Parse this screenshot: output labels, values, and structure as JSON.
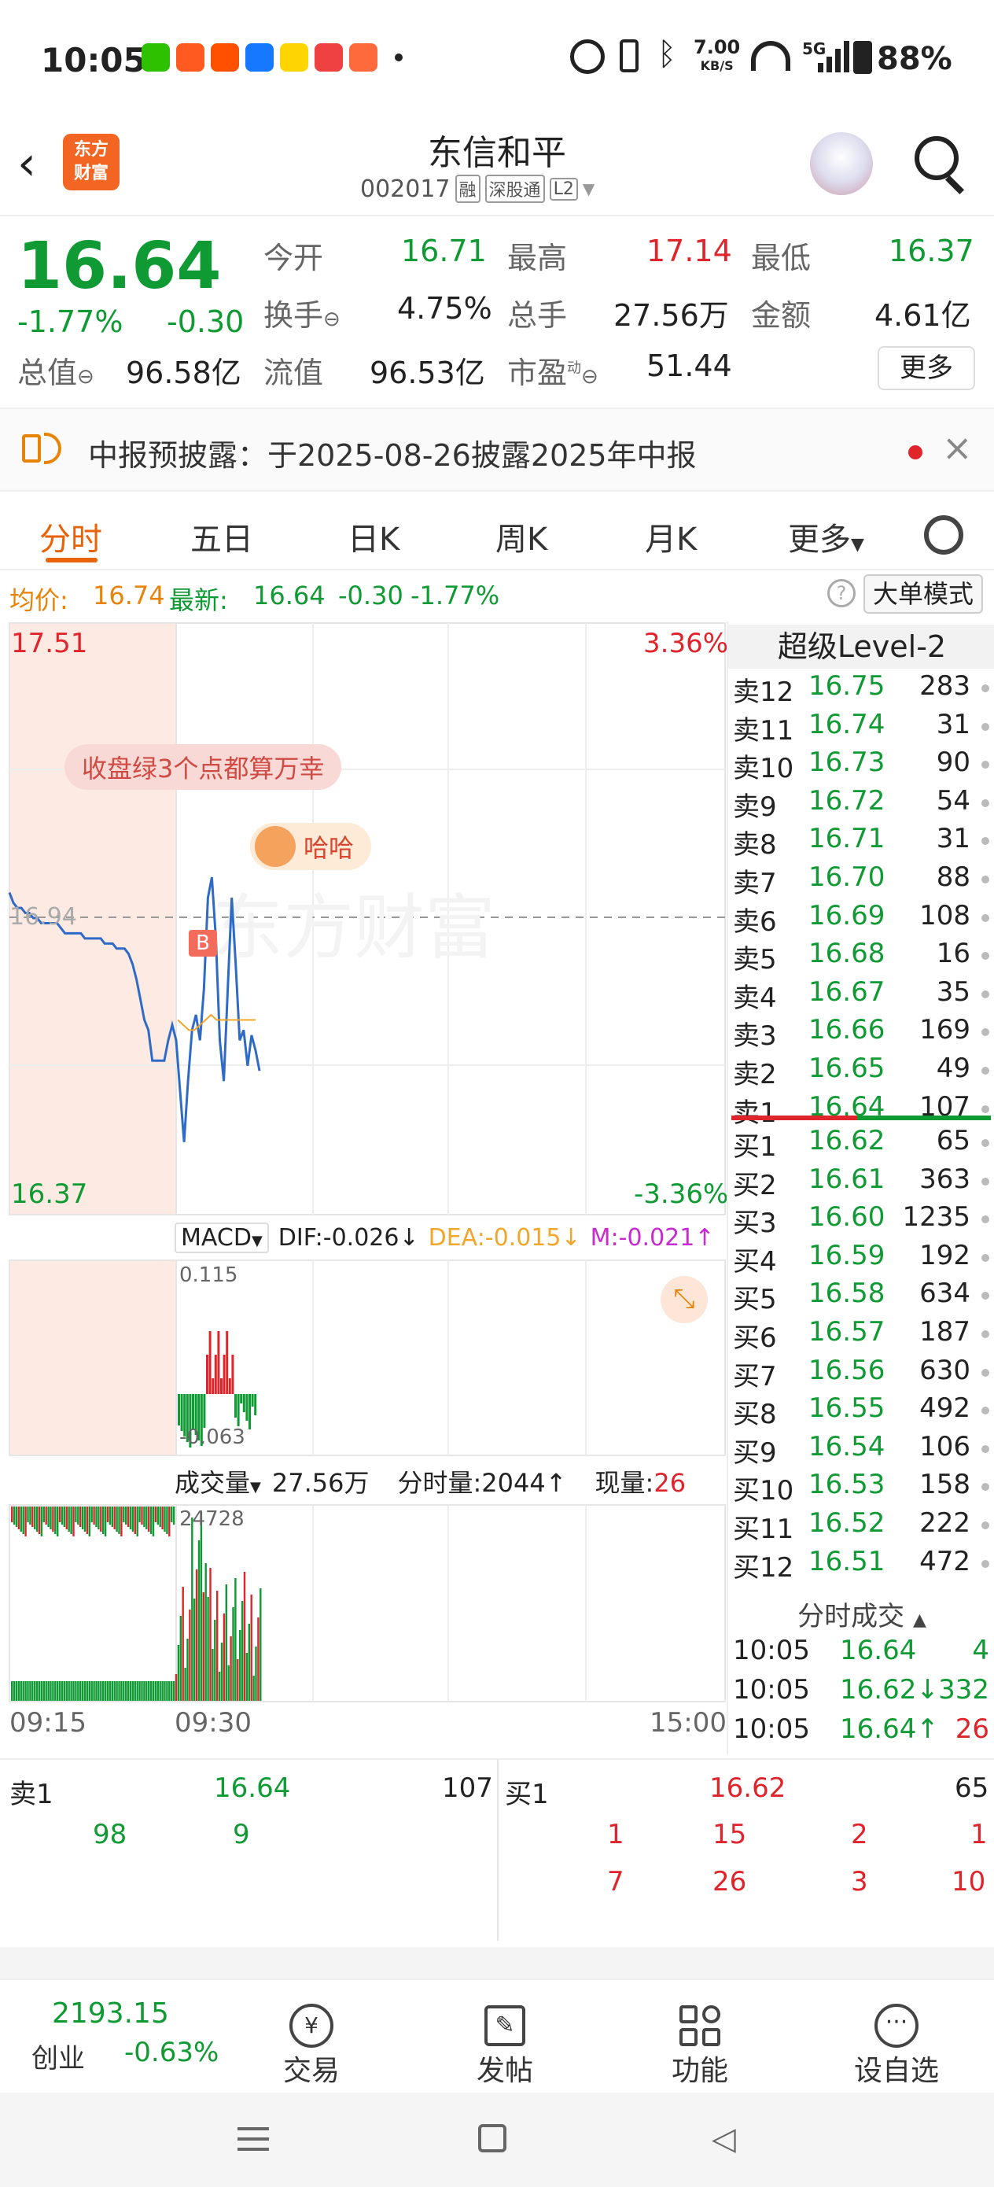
{
  "status": {
    "time": "10:05",
    "net_speed_top": "7.00",
    "net_speed_unit": "KB/S",
    "signal": "5G",
    "battery": "88%",
    "notification_icons": [
      "wechat-icon",
      "app-icon",
      "taobao-icon",
      "alipay-icon",
      "game-icon",
      "toutiao-icon",
      "app2-icon"
    ]
  },
  "header": {
    "title": "东信和平",
    "code": "002017",
    "tag_rong": "融",
    "tag_sgt": "深股通",
    "tag_l2": "L2",
    "logo_line1": "东方",
    "logo_line2": "财富"
  },
  "quote": {
    "price": "16.64",
    "change_pct": "-1.77%",
    "change": "-0.30",
    "open_label": "今开",
    "open": "16.71",
    "high_label": "最高",
    "high": "17.14",
    "low_label": "最低",
    "low": "16.37",
    "turnover_label": "换手",
    "turnover": "4.75%",
    "volume_label": "总手",
    "volume": "27.56万",
    "amount_label": "金额",
    "amount": "4.61亿",
    "mktcap_label": "总值",
    "mktcap": "96.58亿",
    "float_label": "流值",
    "float": "96.53亿",
    "pe_label": "市盈",
    "pe_sup": "动",
    "pe": "51.44",
    "more": "更多"
  },
  "notice": {
    "text": "中报预披露：于2025-08-26披露2025年中报"
  },
  "tabs": [
    "分时",
    "五日",
    "日K",
    "周K",
    "月K",
    "更多"
  ],
  "avgline": {
    "avg_label": "均价:",
    "avg": "16.74",
    "latest_label": "最新:",
    "latest": "16.64",
    "chg": "-0.30",
    "pct": "-1.77%",
    "big_mode": "大单模式"
  },
  "chart": {
    "top_price": "17.51",
    "top_pct": "3.36%",
    "bottom_price": "16.37",
    "bottom_pct": "-3.36%",
    "ref_price": "16.94",
    "bubble1": "收盘绿3个点都算万幸",
    "bubble2": "哈哈",
    "watermark": "东方财富",
    "b_marker": "B",
    "macd": {
      "label": "MACD",
      "dif": "DIF:-0.026↓",
      "dea": "DEA:-0.015↓",
      "m": "M:-0.021↑",
      "max": "0.115",
      "min": "-0.063"
    },
    "vol": {
      "label": "成交量",
      "total": "27.56万",
      "minute_label": "分时量:2044↑",
      "now_label": "现量:",
      "now": "26",
      "max": "24728"
    },
    "times": [
      "09:15",
      "09:30",
      "15:00"
    ],
    "price_series": [
      16.99,
      16.97,
      16.96,
      16.96,
      16.95,
      16.95,
      16.94,
      16.94,
      16.93,
      16.93,
      16.93,
      16.93,
      16.93,
      16.92,
      16.91,
      16.91,
      16.91,
      16.91,
      16.91,
      16.9,
      16.9,
      16.9,
      16.9,
      16.9,
      16.89,
      16.89,
      16.89,
      16.88,
      16.88,
      16.88,
      16.87,
      16.85,
      16.82,
      16.78,
      16.74,
      16.72,
      16.66,
      16.66,
      16.66,
      16.66,
      16.7,
      16.73,
      16.7,
      16.6,
      16.5,
      16.62,
      16.72,
      16.75,
      16.7,
      16.8,
      16.98,
      17.02,
      16.9,
      16.7,
      16.62,
      16.8,
      16.98,
      16.85,
      16.7,
      16.72,
      16.65,
      16.71,
      16.68,
      16.64
    ],
    "avg_series": [
      16.74,
      16.73,
      16.72,
      16.72,
      16.73,
      16.74,
      16.75,
      16.74,
      16.74,
      16.74,
      16.74,
      16.74,
      16.74,
      16.74,
      16.74
    ]
  },
  "level2": {
    "title": "超级Level-2",
    "asks": [
      [
        "卖12",
        "16.75",
        "283"
      ],
      [
        "卖11",
        "16.74",
        "31"
      ],
      [
        "卖10",
        "16.73",
        "90"
      ],
      [
        "卖9",
        "16.72",
        "54"
      ],
      [
        "卖8",
        "16.71",
        "31"
      ],
      [
        "卖7",
        "16.70",
        "88"
      ],
      [
        "卖6",
        "16.69",
        "108"
      ],
      [
        "卖5",
        "16.68",
        "16"
      ],
      [
        "卖4",
        "16.67",
        "35"
      ],
      [
        "卖3",
        "16.66",
        "169"
      ],
      [
        "卖2",
        "16.65",
        "49"
      ],
      [
        "卖1",
        "16.64",
        "107"
      ]
    ],
    "bids": [
      [
        "买1",
        "16.62",
        "65"
      ],
      [
        "买2",
        "16.61",
        "363"
      ],
      [
        "买3",
        "16.60",
        "1235"
      ],
      [
        "买4",
        "16.59",
        "192"
      ],
      [
        "买5",
        "16.58",
        "634"
      ],
      [
        "买6",
        "16.57",
        "187"
      ],
      [
        "买7",
        "16.56",
        "630"
      ],
      [
        "买8",
        "16.55",
        "492"
      ],
      [
        "买9",
        "16.54",
        "106"
      ],
      [
        "买10",
        "16.53",
        "158"
      ],
      [
        "买11",
        "16.52",
        "222"
      ],
      [
        "买12",
        "16.51",
        "472"
      ]
    ],
    "ticks_title": "分时成交",
    "ticks": [
      [
        "10:05",
        "16.64",
        "",
        "4"
      ],
      [
        "10:05",
        "16.62↓",
        "",
        "332"
      ],
      [
        "10:05",
        "16.64↑",
        "",
        "26"
      ]
    ]
  },
  "trade": {
    "sell1_label": "卖1",
    "sell1_price": "16.64",
    "sell1_vol": "107",
    "buy1_label": "买1",
    "buy1_price": "16.62",
    "buy1_vol": "65",
    "sell_queue": [
      "98",
      "9"
    ],
    "buy_queue_row1": [
      "1",
      "15",
      "2",
      "1"
    ],
    "buy_queue_row2": [
      "7",
      "26",
      "3",
      "10"
    ]
  },
  "bottomnav": {
    "index_value": "2193.15",
    "index_name": "创业",
    "index_pct": "-0.63%",
    "items": [
      "交易",
      "发帖",
      "功能",
      "设自选"
    ]
  }
}
